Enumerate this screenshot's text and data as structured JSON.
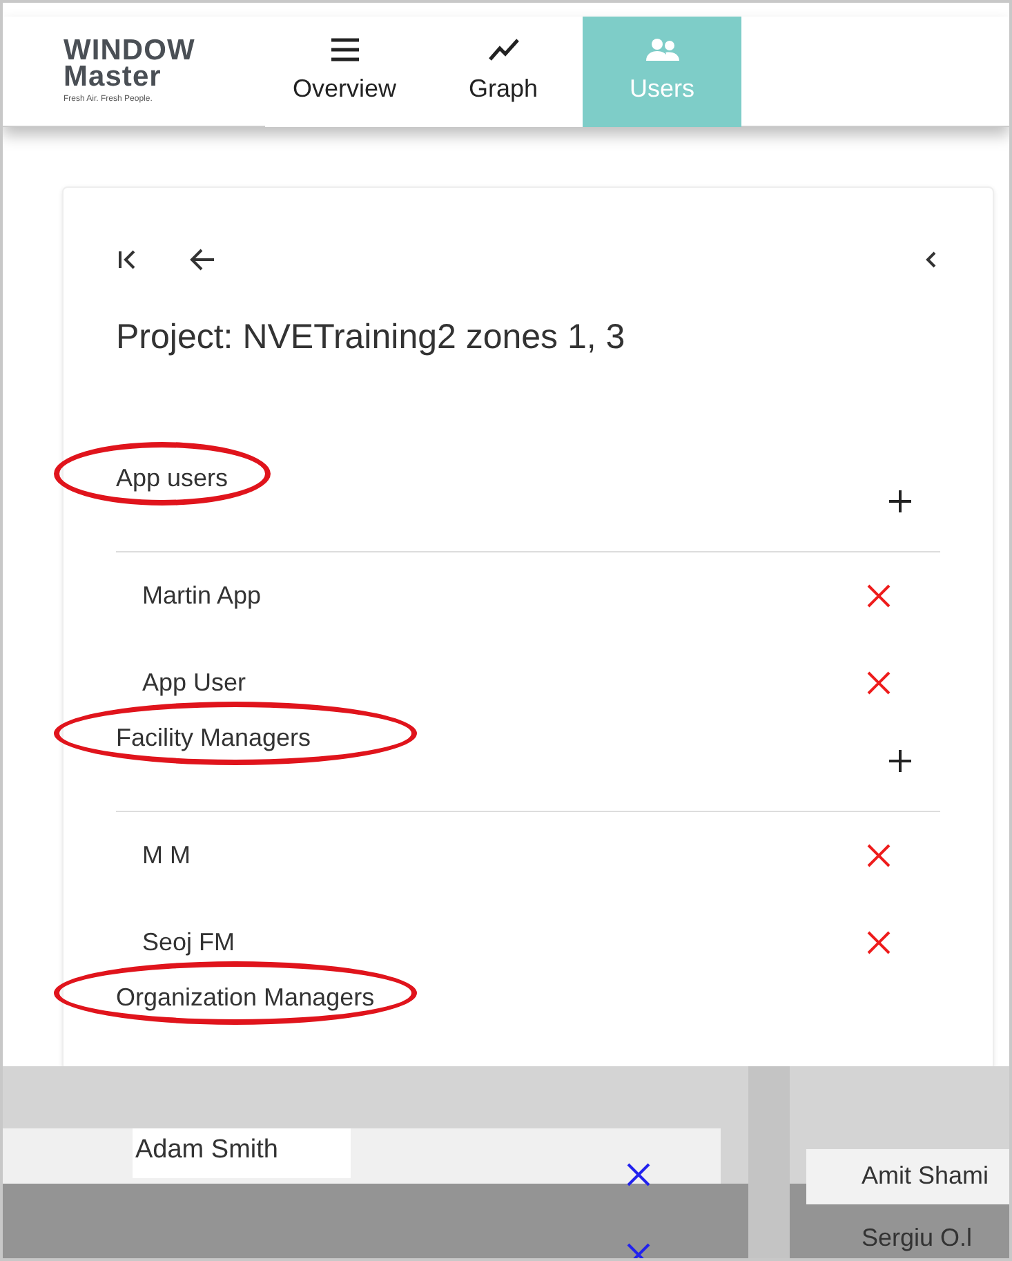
{
  "logo": {
    "name": "WINDOW Master",
    "tagline": "Fresh Air. Fresh People."
  },
  "nav": [
    {
      "label": "Overview",
      "kind": "menu",
      "selected": false
    },
    {
      "label": "Graph",
      "kind": "graph",
      "selected": false
    },
    {
      "label": "Users",
      "kind": "users",
      "selected": true
    }
  ],
  "project_title": "Project: NVETraining2 zones 1, 3",
  "groups": [
    {
      "title": "App users",
      "circled": true,
      "users": [
        "Martin App",
        "App User"
      ]
    },
    {
      "title": "Facility Managers",
      "circled": true,
      "users": [
        "M M",
        "Seoj FM"
      ]
    },
    {
      "title": "Organization Managers",
      "circled": true
    }
  ],
  "glitch": {
    "left_user": "Adam Smith",
    "right_users": [
      "Amit Shami",
      "Sergiu O.l"
    ]
  }
}
